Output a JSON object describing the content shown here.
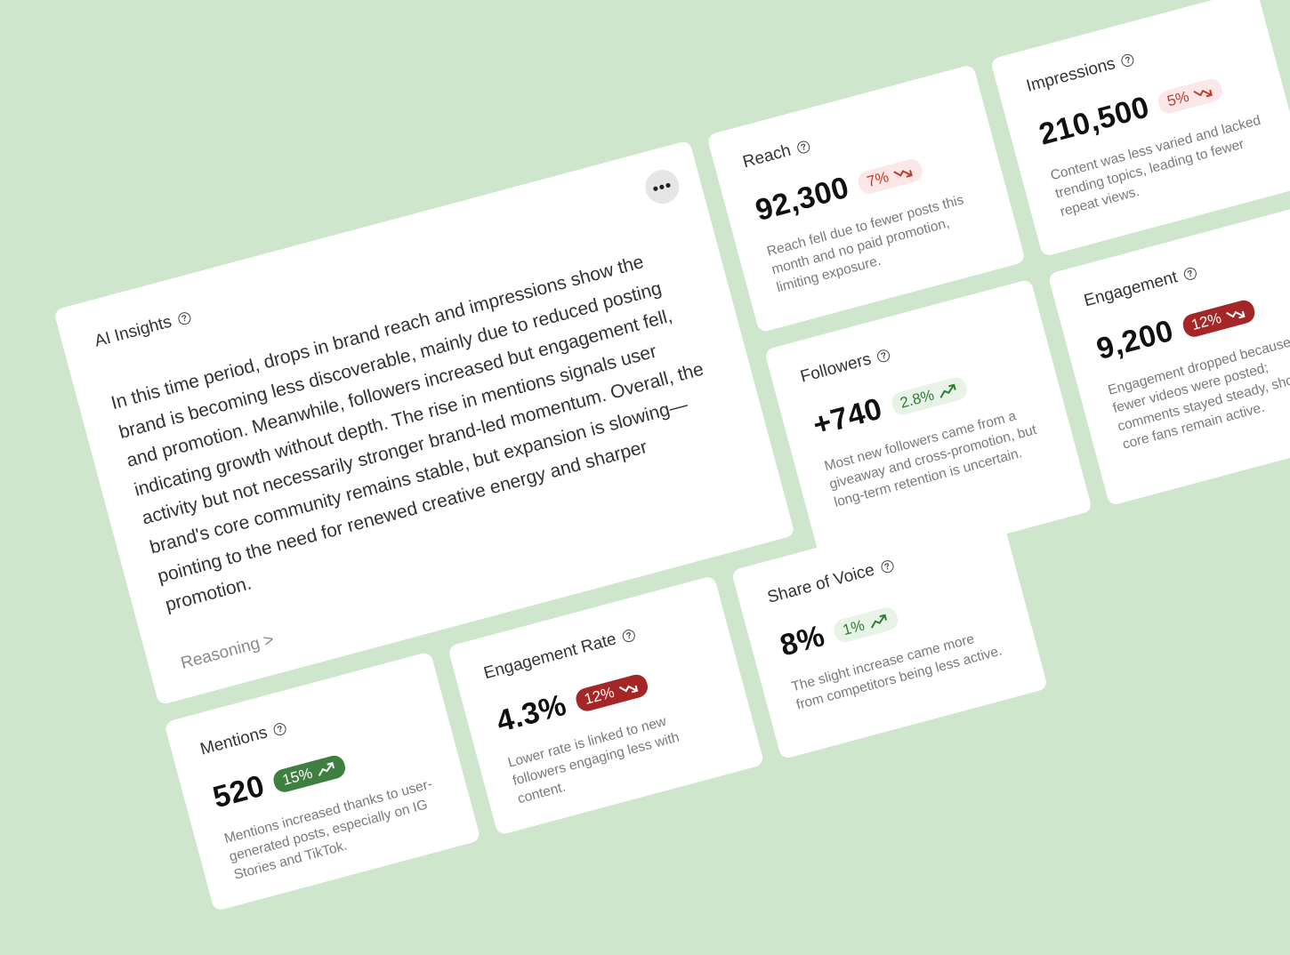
{
  "insights": {
    "title": "AI Insights",
    "body": "In this time period, drops in brand reach and impressions show the brand is becoming less discoverable, mainly due to reduced posting and promotion. Meanwhile, followers increased but engagement fell, indicating growth without depth. The rise in mentions signals user activity but not necessarily stronger brand-led momentum. Overall, the brand's core community remains stable, but expansion is slowing—pointing to the need for renewed creative energy and sharper promotion.",
    "reasoning_link": "Reasoning >",
    "more_icon": "more-horizontal-icon"
  },
  "metrics": {
    "reach": {
      "title": "Reach",
      "value": "92,300",
      "change": "7%",
      "trend": "down",
      "description": "Reach fell due to fewer posts this month and no paid promotion, limiting exposure."
    },
    "impressions": {
      "title": "Impressions",
      "value": "210,500",
      "change": "5%",
      "trend": "down",
      "description": "Content was less varied and lacked trending topics, leading to fewer repeat views."
    },
    "followers": {
      "title": "Followers",
      "value": "+740",
      "change": "2.8%",
      "trend": "up",
      "description": "Most new followers came from a giveaway and cross-promotion, but long-term retention is uncertain."
    },
    "engagement": {
      "title": "Engagement",
      "value": "9,200",
      "change": "12%",
      "trend": "down",
      "description": "Engagement dropped because fewer videos were posted; comments stayed steady, showing core fans remain active."
    },
    "mentions": {
      "title": "Mentions",
      "value": "520",
      "change": "15%",
      "trend": "up",
      "description": "Mentions increased thanks to user-generated posts, especially on IG Stories and TikTok."
    },
    "engagement_rate": {
      "title": "Engagement Rate",
      "value": "4.3%",
      "change": "12%",
      "trend": "down",
      "description": "Lower rate is linked to new followers engaging less with content."
    },
    "share_of_voice": {
      "title": "Share of Voice",
      "value": "8%",
      "change": "1%",
      "trend": "up",
      "description": "The slight increase came more from competitors being less active."
    }
  },
  "colors": {
    "background": "#cde6cc",
    "down_light_bg": "#fbe7e7",
    "down_strong_bg": "#a52626",
    "up_light_bg": "#e6f3e6",
    "up_strong_bg": "#3f7f3f"
  },
  "icons": {
    "help": "help-circle-icon",
    "trend_down": "trending-down-icon",
    "trend_up": "trending-up-icon"
  }
}
